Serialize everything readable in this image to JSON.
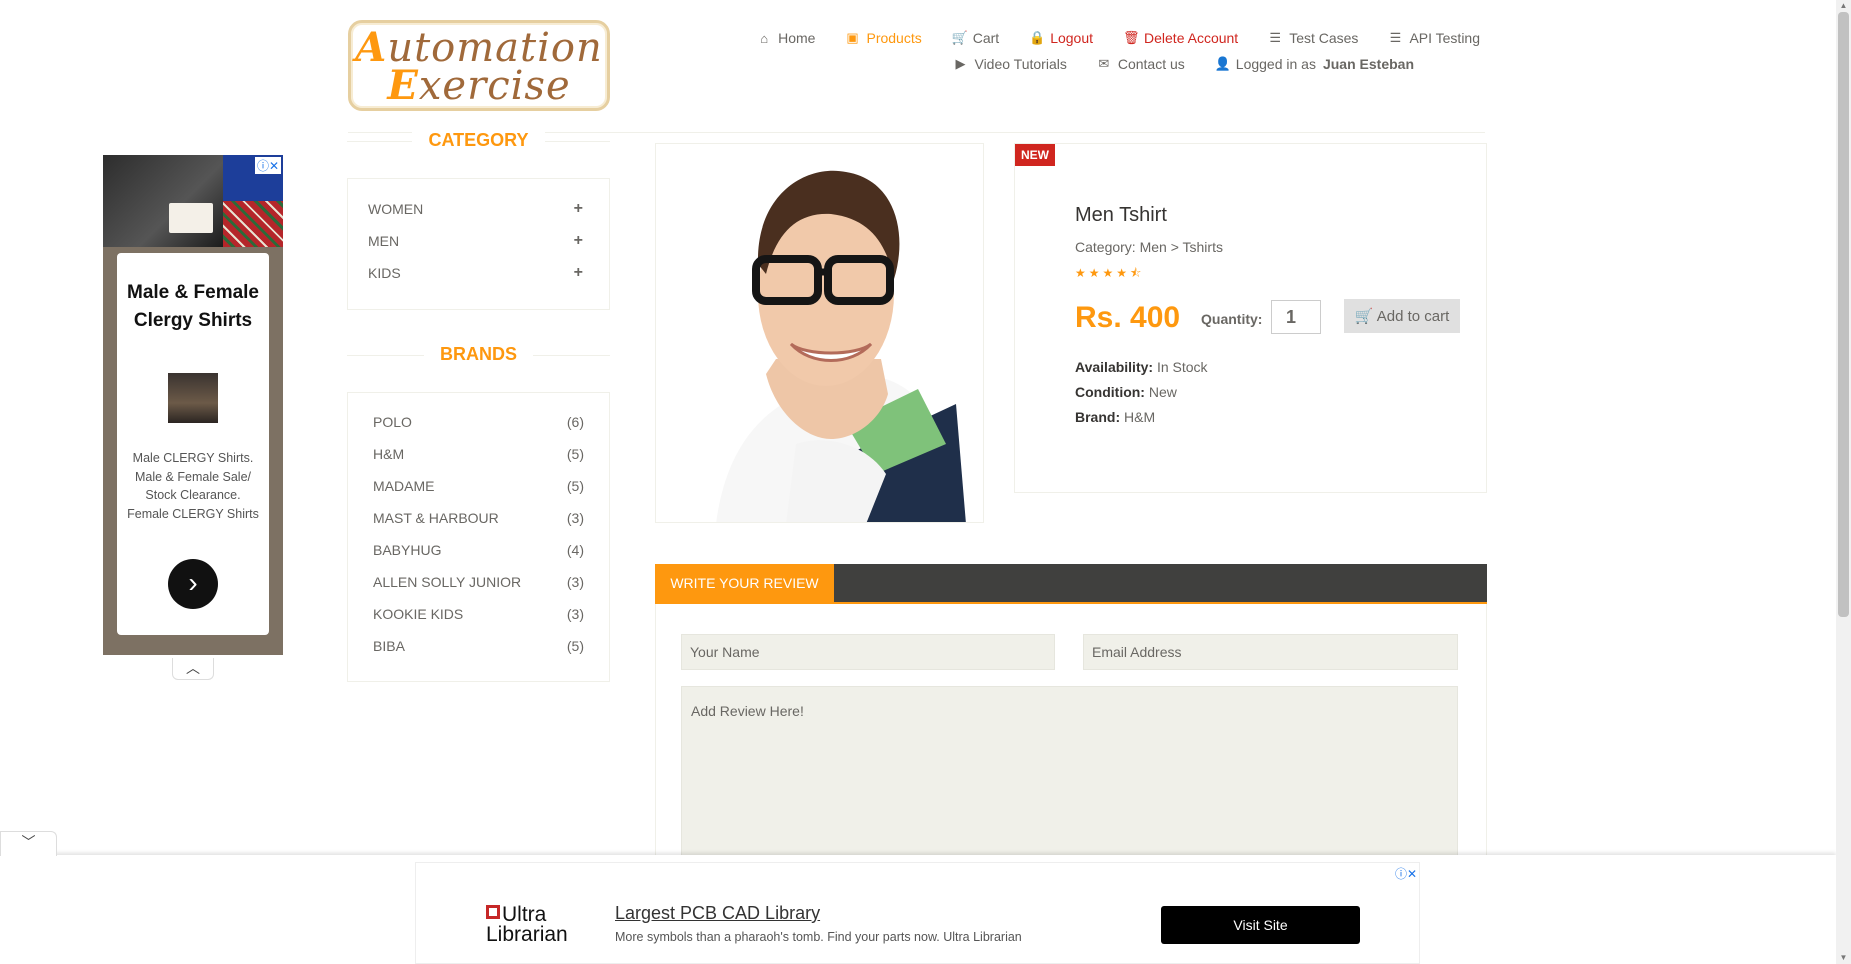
{
  "logo": {
    "line1_cap": "A",
    "line1_rest": "utomation",
    "line2_cap": "E",
    "line2_rest": "xercise"
  },
  "nav": {
    "row1": [
      {
        "icon": "home-icon",
        "glyph": "⌂",
        "label": "Home"
      },
      {
        "icon": "briefcase-icon",
        "glyph": "▣",
        "label": "Products"
      },
      {
        "icon": "cart-icon",
        "glyph": "🛒",
        "label": "Cart"
      },
      {
        "icon": "lock-icon",
        "glyph": "🔒",
        "label": "Logout"
      },
      {
        "icon": "trash-icon",
        "glyph": "🗑",
        "label": "Delete Account"
      },
      {
        "icon": "list-icon",
        "glyph": "☰",
        "label": "Test Cases"
      },
      {
        "icon": "list-icon",
        "glyph": "☰",
        "label": "API Testing"
      }
    ],
    "row2": [
      {
        "icon": "youtube-icon",
        "glyph": "▶",
        "label": "Video Tutorials"
      },
      {
        "icon": "envelope-icon",
        "glyph": "✉",
        "label": "Contact us"
      },
      {
        "icon": "user-icon",
        "glyph": "👤",
        "label": "Logged in as",
        "user": "Juan Esteban"
      }
    ]
  },
  "left_ad": {
    "title": "Male & Female Clergy Shirts",
    "text": "Male CLERGY Shirts. Male & Female Sale/ Stock Clearance. Female CLERGY Shirts",
    "go_glyph": "›",
    "close": "ⓘ✕",
    "collapse_glyph": "︿"
  },
  "sidebar": {
    "category_title": "CATEGORY",
    "categories": [
      {
        "label": "WOMEN",
        "toggle": "+"
      },
      {
        "label": "MEN",
        "toggle": "+"
      },
      {
        "label": "KIDS",
        "toggle": "+"
      }
    ],
    "brands_title": "BRANDS",
    "brands": [
      {
        "label": "POLO",
        "count": "(6)"
      },
      {
        "label": "H&M",
        "count": "(5)"
      },
      {
        "label": "MADAME",
        "count": "(5)"
      },
      {
        "label": "MAST & HARBOUR",
        "count": "(3)"
      },
      {
        "label": "BABYHUG",
        "count": "(4)"
      },
      {
        "label": "ALLEN SOLLY JUNIOR",
        "count": "(3)"
      },
      {
        "label": "KOOKIE KIDS",
        "count": "(3)"
      },
      {
        "label": "BIBA",
        "count": "(5)"
      }
    ]
  },
  "product": {
    "badge": "NEW",
    "name": "Men Tshirt",
    "category": "Category: Men > Tshirts",
    "stars": "★★★★⯪",
    "rating": 4.5,
    "price": "Rs. 400",
    "quantity_label": "Quantity:",
    "quantity_value": "1",
    "add_to_cart": "Add to cart",
    "availability_label": "Availability:",
    "availability": "In Stock",
    "condition_label": "Condition:",
    "condition": "New",
    "brand_label": "Brand:",
    "brand": "H&M"
  },
  "review": {
    "tab": "WRITE YOUR REVIEW",
    "name_placeholder": "Your Name",
    "email_placeholder": "Email Address",
    "review_placeholder": "Add Review Here!"
  },
  "bottom_ad": {
    "logo_line1": "Ultra",
    "logo_line2": "Librarian",
    "title": "Largest PCB CAD Library",
    "desc": "More symbols than a pharaoh's tomb. Find your parts now. Ultra Librarian",
    "button": "Visit Site",
    "close": "ⓘ✕",
    "toggle_glyph": "﹀"
  },
  "colors": {
    "accent": "#fe980f",
    "danger": "#d0261f",
    "dark_bar": "#40403e",
    "input_bg": "#f0f0e9"
  }
}
